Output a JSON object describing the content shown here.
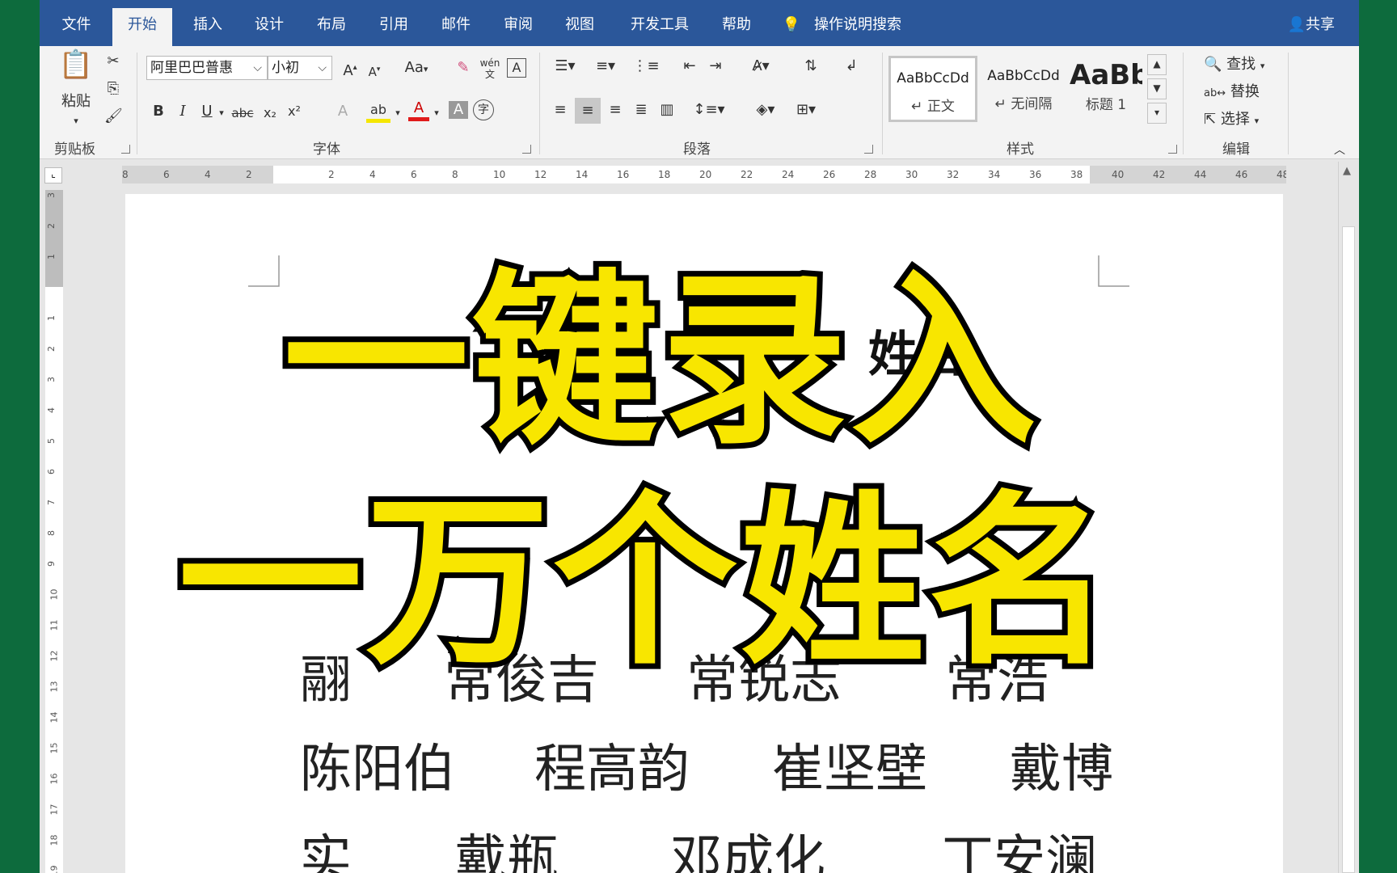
{
  "tabs": [
    "文件",
    "开始",
    "插入",
    "设计",
    "布局",
    "引用",
    "邮件",
    "审阅",
    "视图",
    "开发工具",
    "帮助"
  ],
  "active_tab": "开始",
  "tell_me": "操作说明搜索",
  "share": "共享",
  "clipboard": {
    "paste": "粘贴",
    "label": "剪贴板"
  },
  "font": {
    "name": "阿里巴巴普惠",
    "size": "小初",
    "label": "字体",
    "case_btn": "Aa",
    "bold": "B",
    "italic": "I",
    "underline": "U",
    "strike": "abc",
    "sub": "x₂",
    "sup": "x²",
    "phonetic": "wén"
  },
  "paragraph": {
    "label": "段落"
  },
  "styles": {
    "label": "样式",
    "items": [
      {
        "preview": "AaBbCcDd",
        "name": "↵ 正文"
      },
      {
        "preview": "AaBbCcDd",
        "name": "↵ 无间隔"
      },
      {
        "preview": "AaBb",
        "name": "标题 1"
      }
    ]
  },
  "editing": {
    "label": "编辑",
    "find": "查找",
    "replace": "替换",
    "select": "选择"
  },
  "ruler_h": [
    "8",
    "6",
    "4",
    "2",
    "",
    "2",
    "4",
    "6",
    "8",
    "10",
    "12",
    "14",
    "16",
    "18",
    "20",
    "22",
    "24",
    "26",
    "28",
    "30",
    "32",
    "34",
    "36",
    "38",
    "40",
    "42",
    "44",
    "46",
    "48"
  ],
  "ruler_v": [
    "3",
    "2",
    "1",
    "",
    "1",
    "2",
    "3",
    "4",
    "5",
    "6",
    "7",
    "8",
    "9",
    "10",
    "11",
    "12",
    "13",
    "14",
    "15",
    "16",
    "17",
    "18",
    "19"
  ],
  "document": {
    "heading": "姓名",
    "rows": [
      [
        "翮",
        "常俊吉",
        "常锐志",
        "常浩"
      ],
      [
        "陈阳伯",
        "程高韵",
        "崔坚壁",
        "戴博"
      ],
      [
        "实",
        "戴瓶",
        "邓成化",
        "丁安澜"
      ]
    ]
  },
  "overlay": {
    "line1": "一键录入",
    "line2": "一万个姓名"
  },
  "colors": {
    "word_blue": "#2b579a",
    "highlight": "#f8e600",
    "bg_green": "#0d6b3d"
  }
}
